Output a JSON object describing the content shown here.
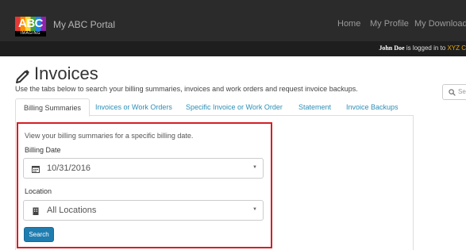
{
  "header": {
    "logo": {
      "text": "ABC",
      "subtext": "IMAGING"
    },
    "portal_title": "My ABC Portal",
    "nav": [
      "Home",
      "My Profile",
      "My Downloads"
    ],
    "user": {
      "name": "John Doe",
      "status_text": "is logged in to",
      "org": "XYZ C"
    }
  },
  "page": {
    "title": "Invoices",
    "title_icon": "pencil-icon",
    "intro": "Use the tabs below to search your billing summaries, invoices and work orders and request invoice backups."
  },
  "search": {
    "placeholder": "Sea"
  },
  "tabs": [
    {
      "label": "Billing Summaries",
      "active": true
    },
    {
      "label": "Invoices or Work Orders",
      "active": false
    },
    {
      "label": "Specific Invoice or Work Order",
      "active": false
    },
    {
      "label": "Statement",
      "active": false
    },
    {
      "label": "Invoice Backups",
      "active": false
    }
  ],
  "form": {
    "description": "View your billing summaries for a specific billing date.",
    "billing_date": {
      "label": "Billing Date",
      "value": "10/31/2016",
      "icon": "calendar-icon"
    },
    "location": {
      "label": "Location",
      "value": "All Locations",
      "icon": "building-icon"
    },
    "submit_label": "Search"
  },
  "colors": {
    "header_bg": "#2b2b2b",
    "link": "#2c8fb6",
    "primary_button": "#1f7db0",
    "highlight_border": "#d41f26",
    "org_name": "#e8a70c"
  }
}
